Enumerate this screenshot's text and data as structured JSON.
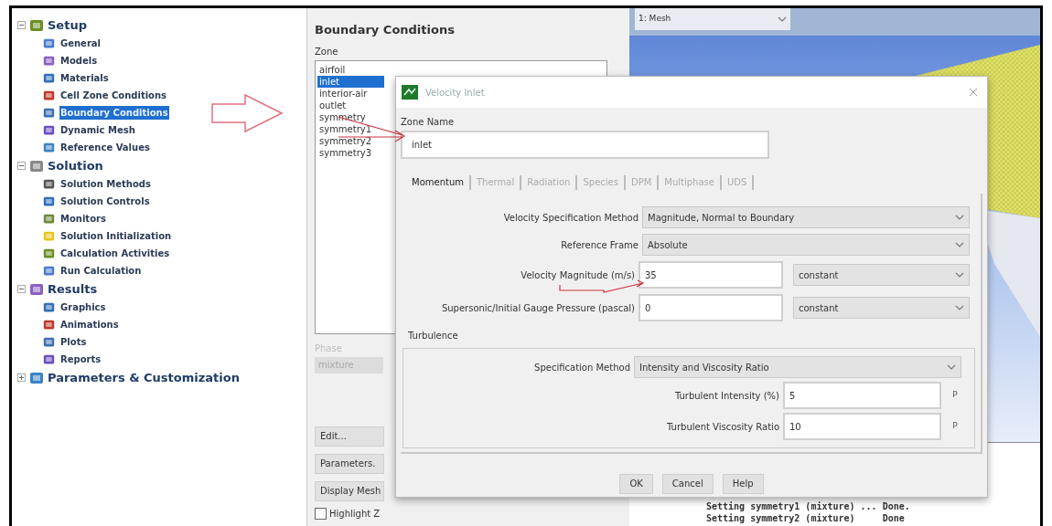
{
  "tree": [
    {
      "label": "Setup",
      "expanded": true,
      "children": [
        {
          "label": "General",
          "selected": false
        },
        {
          "label": "Models",
          "selected": false
        },
        {
          "label": "Materials",
          "selected": false
        },
        {
          "label": "Cell Zone Conditions",
          "selected": false
        },
        {
          "label": "Boundary Conditions",
          "selected": true
        },
        {
          "label": "Dynamic Mesh",
          "selected": false
        },
        {
          "label": "Reference Values",
          "selected": false
        }
      ]
    },
    {
      "label": "Solution",
      "expanded": true,
      "children": [
        {
          "label": "Solution Methods",
          "selected": false
        },
        {
          "label": "Solution Controls",
          "selected": false
        },
        {
          "label": "Monitors",
          "selected": false
        },
        {
          "label": "Solution Initialization",
          "selected": false
        },
        {
          "label": "Calculation Activities",
          "selected": false
        },
        {
          "label": "Run Calculation",
          "selected": false
        }
      ]
    },
    {
      "label": "Results",
      "expanded": true,
      "children": [
        {
          "label": "Graphics",
          "selected": false
        },
        {
          "label": "Animations",
          "selected": false
        },
        {
          "label": "Plots",
          "selected": false
        },
        {
          "label": "Reports",
          "selected": false
        }
      ]
    },
    {
      "label": "Parameters & Customization",
      "expanded": false
    }
  ],
  "panel": {
    "title": "Boundary Conditions",
    "zone_label": "Zone",
    "zones": [
      {
        "label": "airfoil",
        "selected": false
      },
      {
        "label": "inlet",
        "selected": true
      },
      {
        "label": "interior-air",
        "selected": false
      },
      {
        "label": "outlet",
        "selected": false
      },
      {
        "label": "symmetry",
        "selected": false
      },
      {
        "label": "symmetry1",
        "selected": false
      },
      {
        "label": "symmetry2",
        "selected": false
      },
      {
        "label": "symmetry3",
        "selected": false
      }
    ],
    "phase_label": "Phase",
    "phase_value": "mixture",
    "phase_disabled": true,
    "buttons": [
      "Edit...",
      "Parameters.",
      "Display Mesh"
    ],
    "highlight": {
      "label": "Highlight Z",
      "checked": false
    }
  },
  "graphics": {
    "view_select": "1: Mesh",
    "console": [
      "Setting symmetry1 (mixture) ... Done.",
      "Setting symmetry2 (mixture)     Done"
    ]
  },
  "dialog": {
    "title": "Velocity Inlet",
    "zone_name_label": "Zone Name",
    "zone_name": "inlet",
    "tabs": [
      {
        "label": "Momentum",
        "selected": true
      },
      {
        "label": "Thermal",
        "selected": false
      },
      {
        "label": "Radiation",
        "selected": false
      },
      {
        "label": "Species",
        "selected": false
      },
      {
        "label": "DPM",
        "selected": false
      },
      {
        "label": "Multiphase",
        "selected": false
      },
      {
        "label": "UDS",
        "selected": false
      }
    ],
    "rows": [
      {
        "kind": "select",
        "label": "Velocity Specification Method",
        "value": "Magnitude, Normal to Boundary"
      },
      {
        "kind": "select",
        "label": "Reference Frame",
        "value": "Absolute"
      },
      {
        "kind": "profile",
        "label": "Velocity Magnitude (m/s)",
        "value": "35",
        "profile": "constant"
      },
      {
        "kind": "profile",
        "label": "Supersonic/Initial Gauge Pressure (pascal)",
        "value": "0",
        "profile": "constant"
      }
    ],
    "turbulence": {
      "title": "Turbulence",
      "rows": [
        {
          "kind": "select",
          "label": "Specification Method",
          "value": "Intensity and Viscosity Ratio"
        },
        {
          "kind": "param",
          "label": "Turbulent Intensity (%)",
          "value": "5",
          "param": "P"
        },
        {
          "kind": "param",
          "label": "Turbulent Viscosity Ratio",
          "value": "10",
          "param": "P"
        }
      ]
    },
    "buttons": [
      "OK",
      "Cancel",
      "Help"
    ]
  }
}
